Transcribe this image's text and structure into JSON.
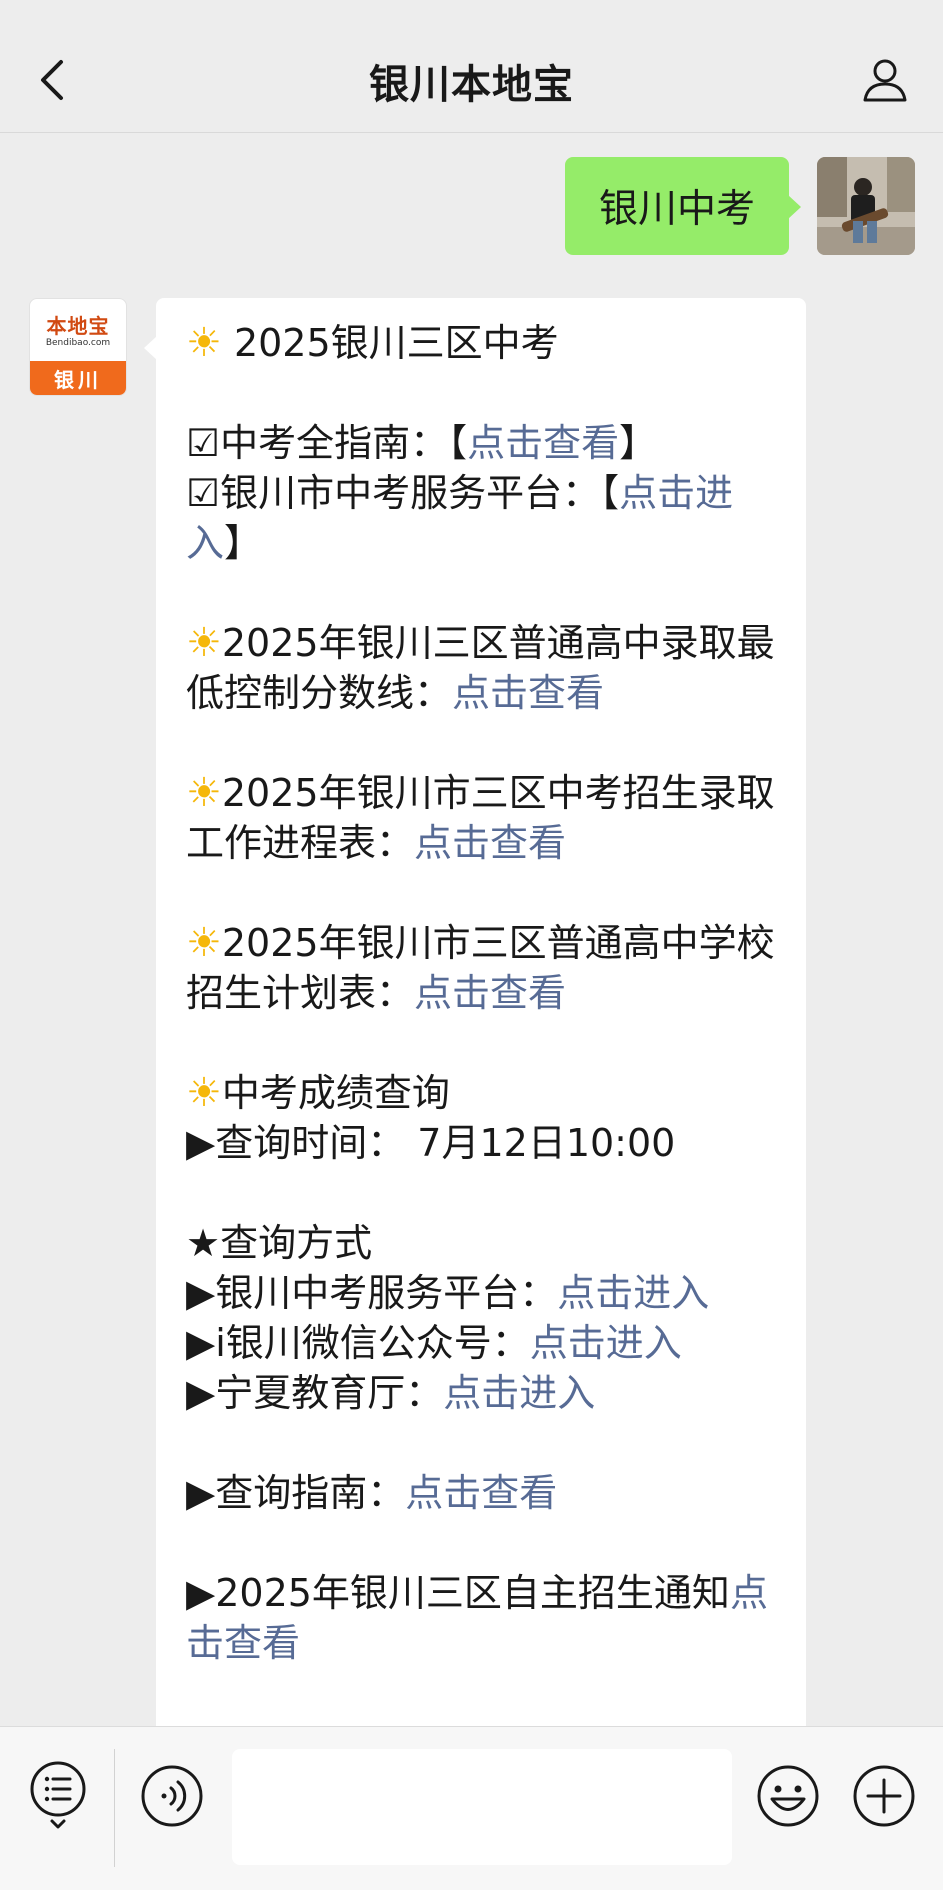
{
  "header": {
    "title": "银川本地宝"
  },
  "sent_message": {
    "text": "银川中考"
  },
  "account_logo": {
    "main": "本地宝",
    "sub": "Bendibao.com",
    "city": "银川"
  },
  "received_message": {
    "heading": "2025银川三区中考",
    "guide_label": "☑中考全指南：【",
    "guide_link": "点击查看",
    "guide_end": "】",
    "platform_label": "☑银川市中考服务平台：【",
    "platform_link": "点击进入",
    "platform_end": "】",
    "item1_text": "2025年银川三区普通高中录取最低控制分数线：",
    "item1_link": "点击查看",
    "item2_text": "2025年银川市三区中考招生录取工作进程表：",
    "item2_link": "点击查看",
    "item3_text": "2025年银川市三区普通高中学校招生计划表：",
    "item3_link": "点击查看",
    "score_heading": "中考成绩查询",
    "query_time": "▶查询时间： 7月12日10:00",
    "method_heading": "★查询方式",
    "method1_text": "▶银川中考服务平台：",
    "method1_link": "点击进入",
    "method2_text": "▶i银川微信公众号：",
    "method2_link": "点击进入",
    "method3_text": "▶宁夏教育厅：",
    "method3_link": "点击进入",
    "guide2_text": "▶查询指南：",
    "guide2_link": "点击查看",
    "notice_text": "▶2025年银川三区自主招生通知",
    "notice_link": "点击查看"
  },
  "input": {
    "value": ""
  }
}
